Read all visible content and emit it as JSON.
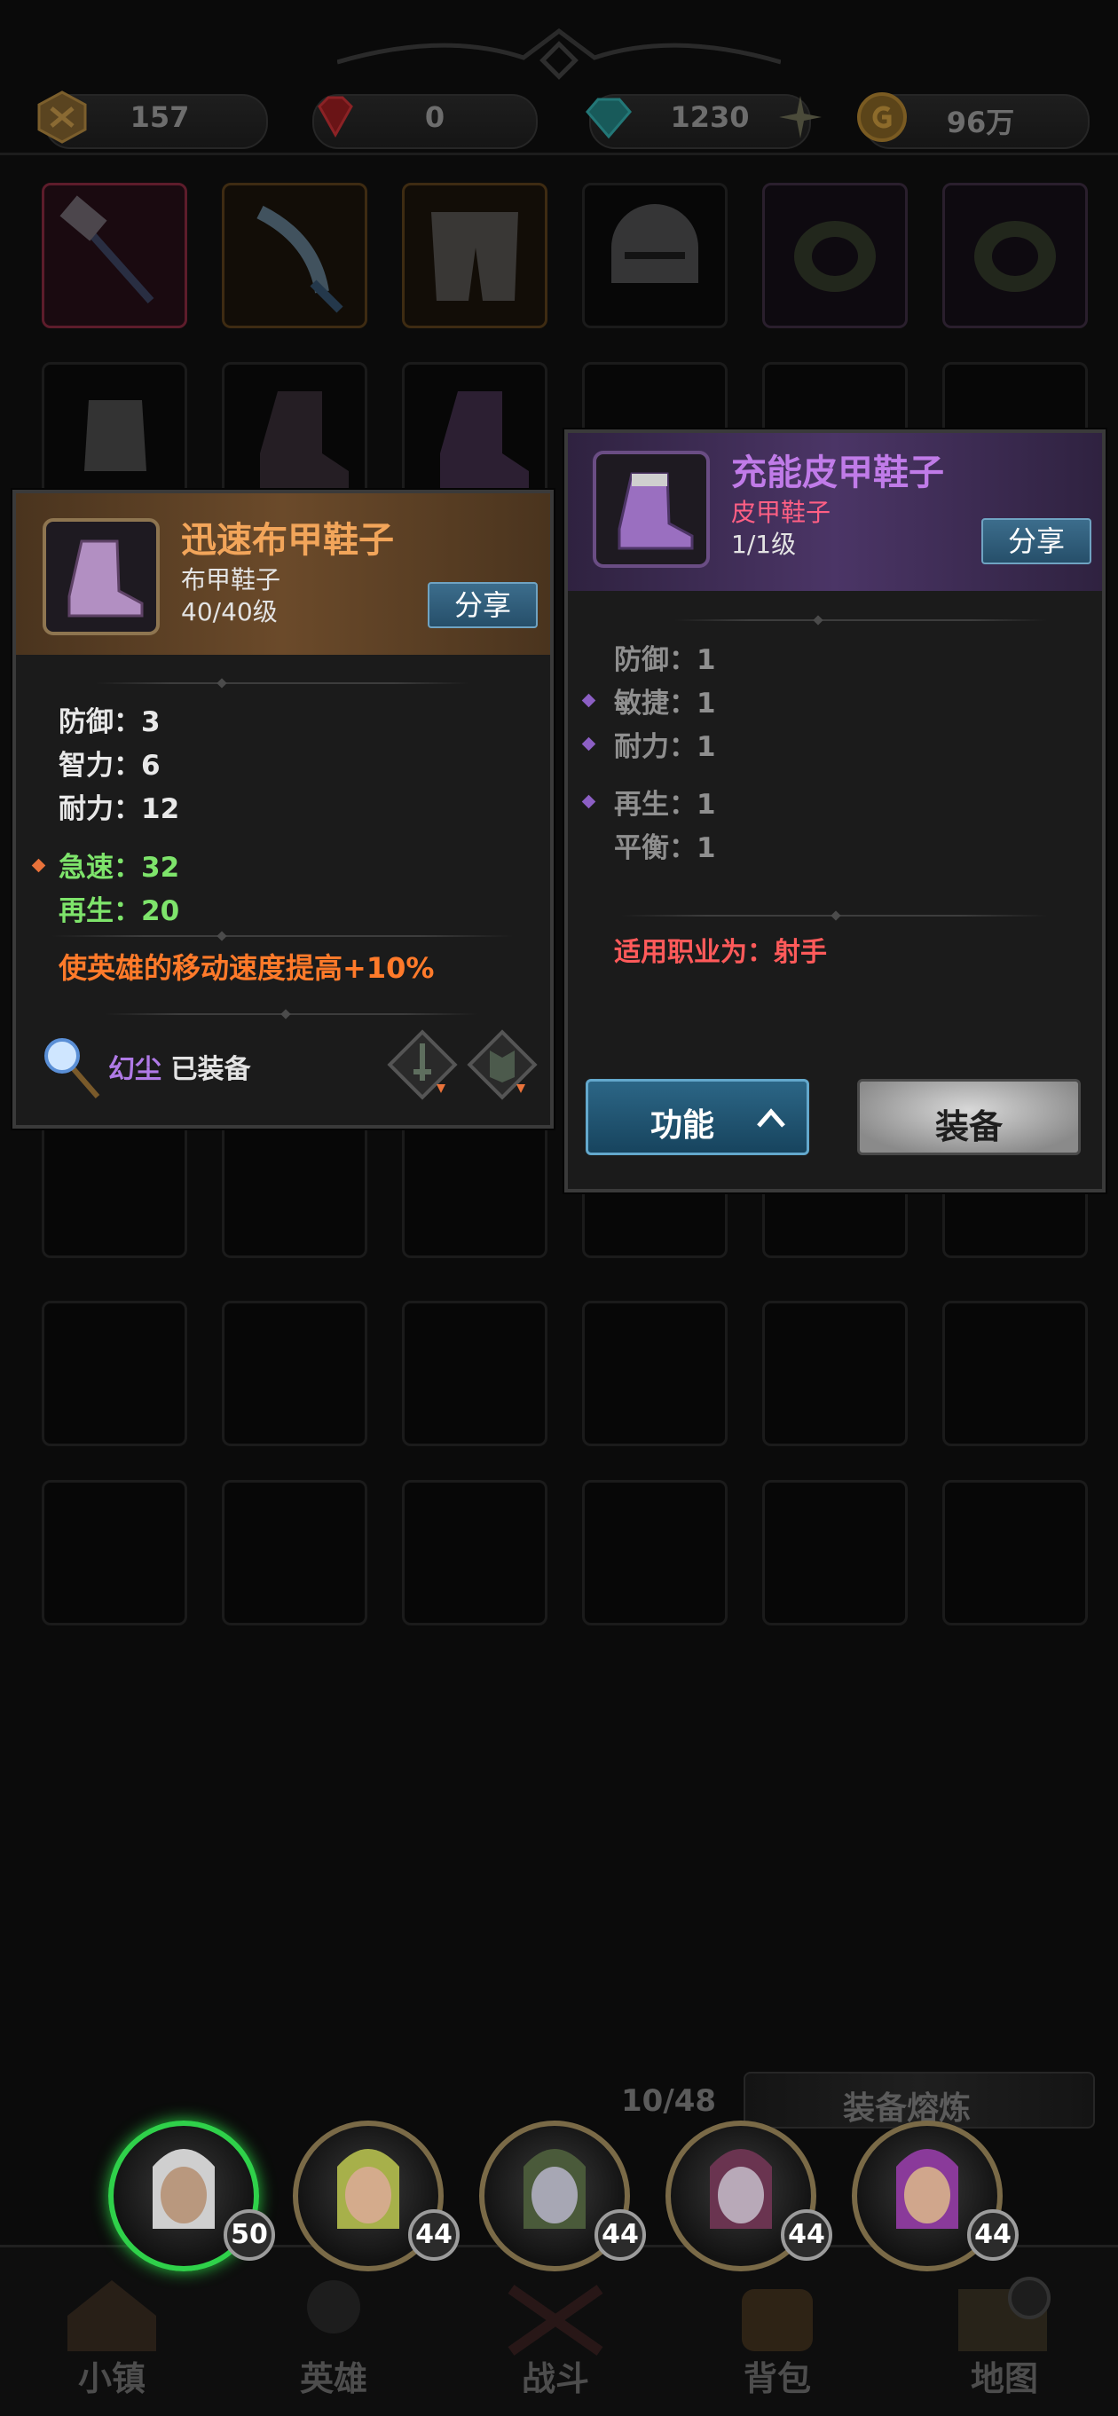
{
  "currency": [
    {
      "icon": "bronze-coin-icon",
      "value": "157"
    },
    {
      "icon": "red-gem-icon",
      "value": "0"
    },
    {
      "icon": "teal-diamond-icon",
      "value": "1230"
    },
    {
      "icon": "gold-coin-icon",
      "value": "96万"
    }
  ],
  "inventory": {
    "row1": [
      "mace-icon",
      "curved-sword-icon",
      "leather-pants-icon",
      "knight-helmet-icon",
      "jade-ring-icon",
      "jade-ring-icon"
    ],
    "row2": [
      "gauntlet-icon",
      "dark-boot-icon",
      "purple-boot-icon"
    ]
  },
  "equipped_item": {
    "name": "迅速布甲鞋子",
    "type": "布甲鞋子",
    "level": "40/40级",
    "share_label": "分享",
    "stats": [
      {
        "label": "防御：",
        "value": "3"
      },
      {
        "label": "智力：",
        "value": "6"
      },
      {
        "label": "耐力：",
        "value": "12"
      }
    ],
    "bonus_stats": [
      {
        "label": "急速：",
        "value": "32"
      },
      {
        "label": "再生：",
        "value": "20"
      }
    ],
    "effect": "使英雄的移动速度提高+10%",
    "equipped_by": "幻尘",
    "equipped_status": "已装备"
  },
  "selected_item": {
    "name": "充能皮甲鞋子",
    "type": "皮甲鞋子",
    "level": "1/1级",
    "share_label": "分享",
    "stats_a": [
      {
        "label": "防御：",
        "value": "1",
        "bullet": false
      },
      {
        "label": "敏捷：",
        "value": "1",
        "bullet": true
      },
      {
        "label": "耐力：",
        "value": "1",
        "bullet": true
      }
    ],
    "stats_b": [
      {
        "label": "再生：",
        "value": "1",
        "bullet": true
      },
      {
        "label": "平衡：",
        "value": "1",
        "bullet": false
      }
    ],
    "class_req": "适用职业为：射手",
    "function_label": "功能",
    "equip_label": "装备"
  },
  "capacity": "10/48",
  "forge_label": "装备熔炼",
  "heroes": [
    {
      "level": "50",
      "selected": true
    },
    {
      "level": "44",
      "selected": false
    },
    {
      "level": "44",
      "selected": false
    },
    {
      "level": "44",
      "selected": false
    },
    {
      "level": "44",
      "selected": false
    }
  ],
  "tabs": [
    "小镇",
    "英雄",
    "战斗",
    "背包",
    "地图"
  ],
  "colors": {
    "item_name_orange": "#f2a55a",
    "item_name_purple": "#c07be8",
    "item_type_pink": "#ff5f84",
    "bonus_green": "#7ee46b",
    "effect_orange": "#ff7a2a",
    "class_req_red": "#ff5a5a",
    "hero_name_purple": "#b07ae6"
  }
}
